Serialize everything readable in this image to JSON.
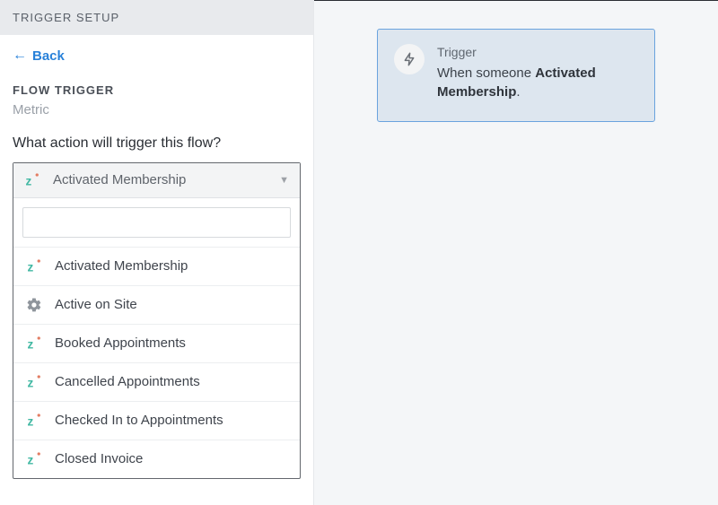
{
  "header": {
    "title": "TRIGGER SETUP"
  },
  "back": {
    "label": "Back"
  },
  "section": {
    "title": "FLOW TRIGGER",
    "subtitle": "Metric"
  },
  "question": "What action will trigger this flow?",
  "dropdown": {
    "selected": "Activated Membership",
    "search_placeholder": "",
    "options": [
      {
        "label": "Activated Membership",
        "icon": "z"
      },
      {
        "label": "Active on Site",
        "icon": "gear"
      },
      {
        "label": "Booked Appointments",
        "icon": "z"
      },
      {
        "label": "Cancelled Appointments",
        "icon": "z"
      },
      {
        "label": "Checked In to Appointments",
        "icon": "z"
      },
      {
        "label": "Closed Invoice",
        "icon": "z"
      }
    ]
  },
  "card": {
    "label": "Trigger",
    "prefix": "When someone ",
    "bold": "Activated Membership",
    "suffix": "."
  }
}
